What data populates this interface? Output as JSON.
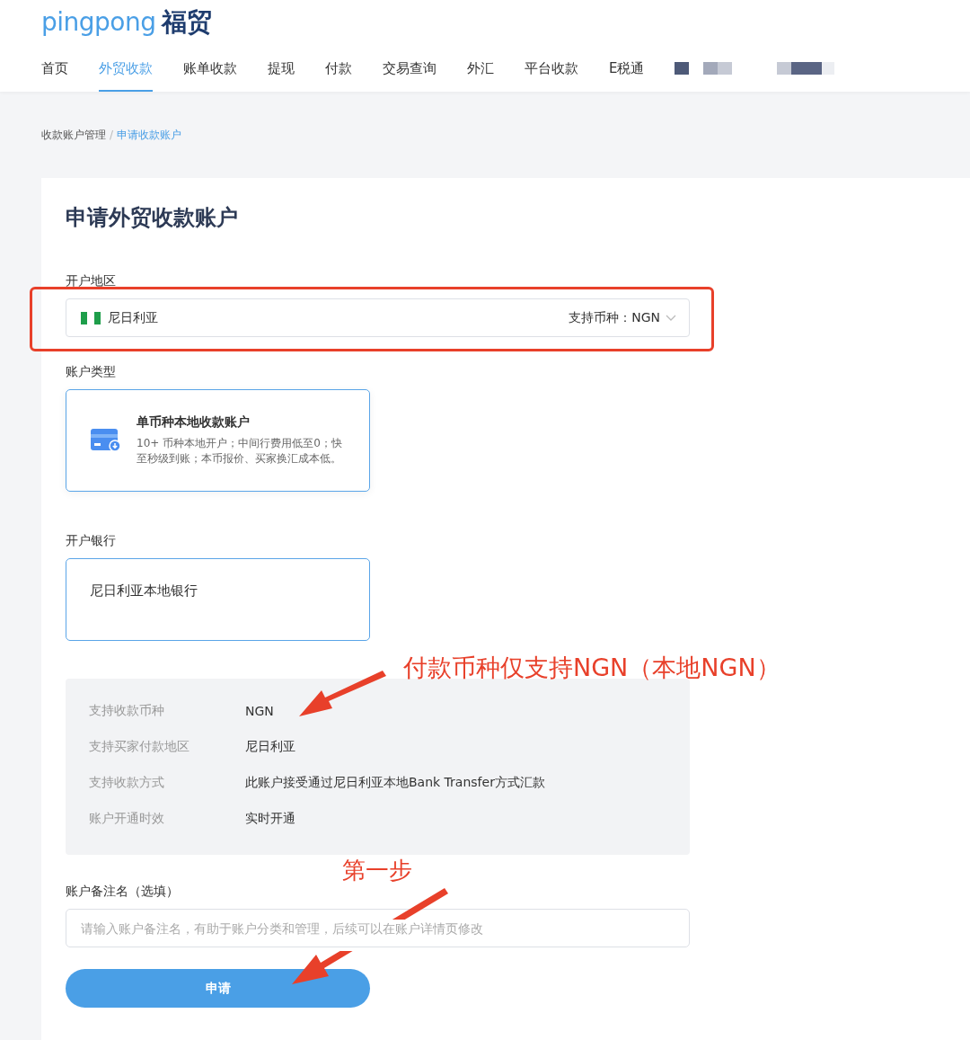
{
  "logo": {
    "latin": "pingpong",
    "chinese": "福贸"
  },
  "nav": [
    {
      "label": "首页",
      "selected": false
    },
    {
      "label": "外贸收款",
      "selected": true
    },
    {
      "label": "账单收款",
      "selected": false
    },
    {
      "label": "提现",
      "selected": false
    },
    {
      "label": "付款",
      "selected": false
    },
    {
      "label": "交易查询",
      "selected": false
    },
    {
      "label": "外汇",
      "selected": false
    },
    {
      "label": "平台收款",
      "selected": false
    },
    {
      "label": "E税通",
      "selected": false
    }
  ],
  "breadcrumb": {
    "items": [
      {
        "label": "收款账户管理",
        "current": false
      },
      {
        "label": "申请收款账户",
        "current": true
      }
    ],
    "separator": "/"
  },
  "title": "申请外贸收款账户",
  "region": {
    "label": "开户地区",
    "value": "尼日利亚",
    "currency_label": "支持币种：",
    "currency": "NGN"
  },
  "account_type": {
    "label": "账户类型",
    "options": [
      {
        "title": "单币种本地收款账户",
        "description": "10+ 币种本地开户；中间行费用低至0；快至秒级到账；本币报价、买家换汇成本低。",
        "selected": true
      }
    ]
  },
  "bank": {
    "label": "开户银行",
    "options": [
      {
        "name": "尼日利亚本地银行",
        "selected": true
      }
    ]
  },
  "details": [
    {
      "key": "支持收款币种",
      "value": "NGN"
    },
    {
      "key": "支持买家付款地区",
      "value": "尼日利亚"
    },
    {
      "key": "支持收款方式",
      "value": "此账户接受通过尼日利亚本地Bank Transfer方式汇款"
    },
    {
      "key": "账户开通时效",
      "value": "实时开通"
    }
  ],
  "remark": {
    "label": "账户备注名（选填）",
    "placeholder": "请输入账户备注名，有助于账户分类和管理，后续可以在账户详情页修改"
  },
  "submit": "申请",
  "annotations": {
    "currency_note": "付款币种仅支持NGN（本地NGN）",
    "step_note": "第一步"
  }
}
